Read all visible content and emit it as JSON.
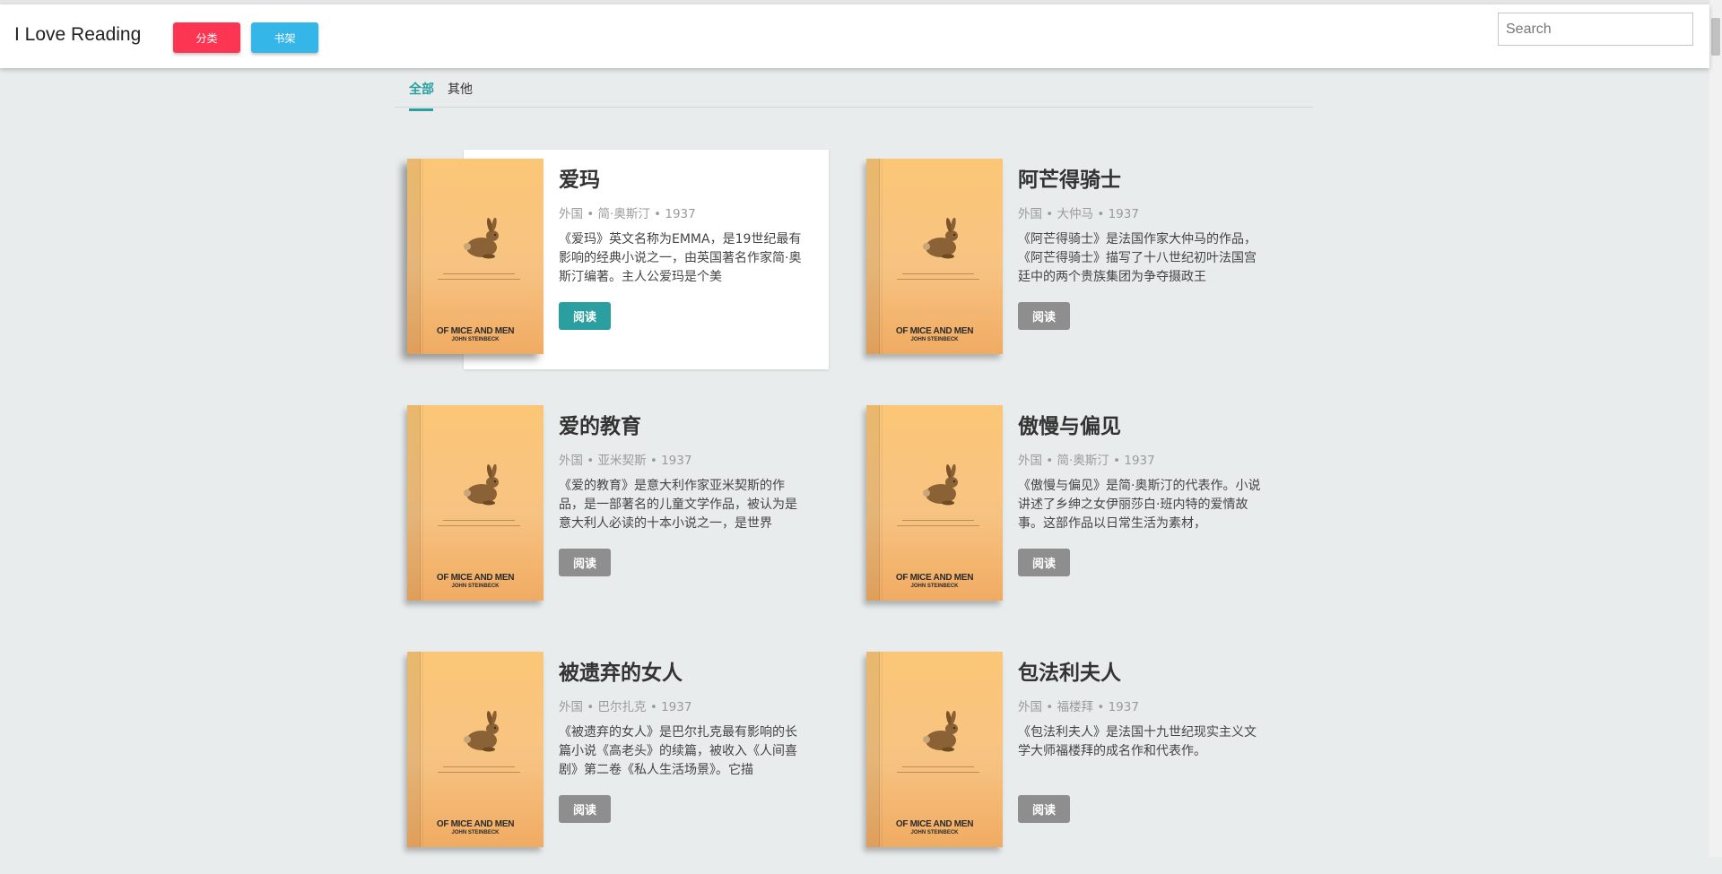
{
  "header": {
    "brand": "I Love Reading",
    "category_button": "分类",
    "shelf_button": "书架",
    "search_placeholder": "Search"
  },
  "tabs": [
    {
      "label": "全部",
      "active": true
    },
    {
      "label": "其他",
      "active": false
    }
  ],
  "cover": {
    "title": "OF MICE AND MEN",
    "author": "JOHN STEINBECK"
  },
  "books": [
    {
      "title": "爱玛",
      "meta": "外国 • 简·奥斯汀 • 1937",
      "desc": "《爱玛》英文名称为EMMA，是19世纪最有影响的经典小说之一，由英国著名作家简·奥斯汀编著。主人公爱玛是个美",
      "read": "阅读",
      "highlight": true
    },
    {
      "title": "阿芒得骑士",
      "meta": "外国 • 大仲马 • 1937",
      "desc": "《阿芒得骑士》是法国作家大仲马的作品，《阿芒得骑士》描写了十八世纪初叶法国宫廷中的两个贵族集团为争夺摄政王",
      "read": "阅读",
      "highlight": false
    },
    {
      "title": "爱的教育",
      "meta": "外国 • 亚米契斯 • 1937",
      "desc": "《爱的教育》是意大利作家亚米契斯的作品，是一部著名的儿童文学作品，被认为是意大利人必读的十本小说之一，是世界",
      "read": "阅读",
      "highlight": false
    },
    {
      "title": "傲慢与偏见",
      "meta": "外国 • 简·奥斯汀 • 1937",
      "desc": "《傲慢与偏见》是简·奥斯汀的代表作。小说讲述了乡绅之女伊丽莎白·班内特的爱情故事。这部作品以日常生活为素材，",
      "read": "阅读",
      "highlight": false
    },
    {
      "title": "被遗弃的女人",
      "meta": "外国 • 巴尔扎克 • 1937",
      "desc": "《被遗弃的女人》是巴尔扎克最有影响的长篇小说《高老头》的续篇，被收入《人间喜剧》第二卷《私人生活场景》。它描",
      "read": "阅读",
      "highlight": false
    },
    {
      "title": "包法利夫人",
      "meta": "外国 • 福楼拜 • 1937",
      "desc": "《包法利夫人》是法国十九世纪现实主义文学大师福楼拜的成名作和代表作。",
      "read": "阅读",
      "highlight": false
    }
  ]
}
